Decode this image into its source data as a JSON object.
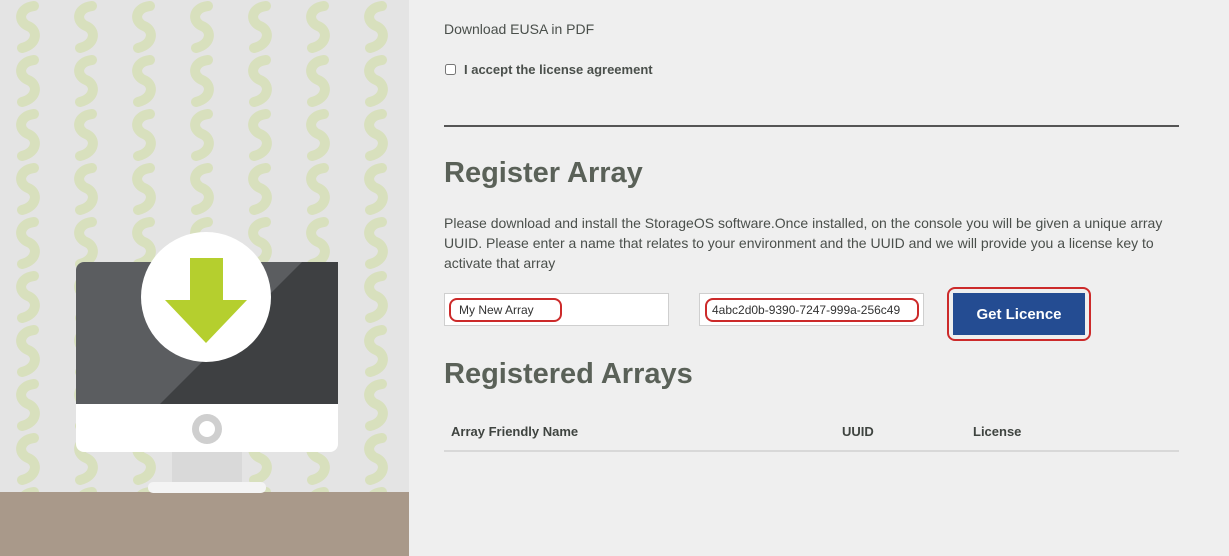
{
  "eusa": {
    "download_link": "Download EUSA in PDF"
  },
  "license_agreement": {
    "label": "I accept the license agreement",
    "checked": false
  },
  "register": {
    "heading": "Register Array",
    "description": "Please download and install the StorageOS software.Once installed, on the console you will be given a unique array UUID. Please enter a name that relates to your environment and the UUID and we will provide you a license key to activate that array",
    "name_value": "My New Array",
    "uuid_value": "4abc2d0b-9390-7247-999a-256c49",
    "button_label": "Get Licence"
  },
  "registered": {
    "heading": "Registered Arrays",
    "columns": [
      "Array Friendly Name",
      "UUID",
      "License"
    ]
  },
  "colors": {
    "button": "#244c92",
    "highlight": "#cc2a2a",
    "heading": "#5a6158",
    "arrow": "#b5cf2e",
    "floor": "#a9998a"
  },
  "illustration": {
    "icon": "download-arrow-icon",
    "device": "monitor"
  }
}
